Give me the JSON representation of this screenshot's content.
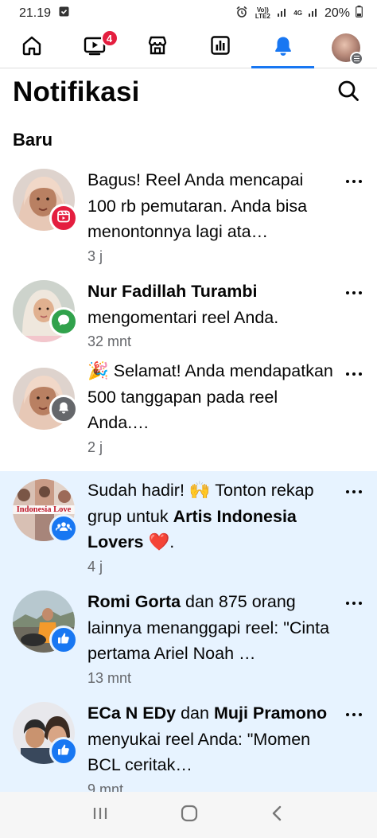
{
  "status_bar": {
    "time": "21.19",
    "network_label": "Vo)) LTE2",
    "network_type": "4G",
    "battery": "20%"
  },
  "nav": {
    "badge_count": "4"
  },
  "header": {
    "title": "Notifikasi"
  },
  "section_label": "Baru",
  "notifications": [
    {
      "text": "Bagus! Reel Anda mencapai 100 rb pemutaran. Anda bisa menontonnya lagi ata…",
      "time": "3 j"
    },
    {
      "actor": "Nur Fadillah Turambi",
      "text": " mengomentari reel Anda.",
      "time": "32 mnt"
    },
    {
      "emoji": "🎉",
      "text": " Selamat! Anda mendapatkan 500 tanggapan pada reel Anda.…",
      "time": "2 j"
    },
    {
      "text_pre": "Sudah hadir! 🙌 Tonton rekap grup untuk ",
      "group": "Artis Indonesia Lovers",
      "heart": "❤️",
      "text_post": ".",
      "time": "4 j",
      "avatar_caption": "Indonesia Love"
    },
    {
      "actor": "Romi Gorta",
      "text": " dan 875 orang lainnya menanggapi reel: \"Cinta pertama Ariel Noah …",
      "time": "13 mnt"
    },
    {
      "actor": "ECa N EDy",
      "connector": " dan ",
      "actor2": "Muji Pramono",
      "text": " menyukai reel Anda: \"Momen BCL ceritak…",
      "time": "9 mnt"
    }
  ],
  "colors": {
    "accent": "#1877f2",
    "unread_bg": "#e7f3ff",
    "reels_badge": "#e41e3f",
    "comment_badge": "#31a24c",
    "bell_badge": "#65676b"
  }
}
